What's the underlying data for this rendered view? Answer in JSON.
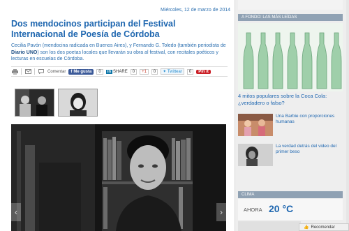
{
  "article": {
    "date": "Miércoles, 12 de marzo de 2014",
    "headline": "Dos mendocinos participan del Festival Internacional de Poesía de Córdoba",
    "lead_part1": "Cecilia Pavón (mendocina radicada en Buenos Aires), y Fernando G. Toledo (también periodista de ",
    "lead_bold": "Diario UNO",
    "lead_part2": ") son los dos poetas locales que llevarán su obra al festival, con recitales poéticos y lecturas en escuelas de Córdoba."
  },
  "toolbar": {
    "comment_label": "Comentar",
    "fb_like_label": "Me gusta",
    "fb_count": "0",
    "in_label": "in",
    "share_label": "SHARE",
    "share_count": "0",
    "gplus_label": "+1",
    "gplus_count": "0",
    "twitter_label": "Twittear",
    "twitter_count": "0",
    "pinit_label": "Pin it"
  },
  "gallery": {
    "prev_symbol": "‹",
    "next_symbol": "›"
  },
  "sidebar": {
    "section_title": "A FONDO: LAS MÁS LEÍDAS",
    "featured_caption": "4 mitos populares sobre la Coca Cola: ¿verdadero o falso?",
    "items": [
      {
        "text": "Una Barbie con proporciones humanas"
      },
      {
        "text": "La verdad detrás del video del primer beso"
      }
    ],
    "clima_title": "CLIMA",
    "ahora_label": "AHORA",
    "temperature": "20 °C"
  },
  "recommend": {
    "label": "Recomendar"
  },
  "colors": {
    "link_blue": "#1f67b0",
    "header_gray_blue": "#8fa1b3",
    "facebook": "#3b5998",
    "linkedin": "#0e76a8",
    "pinterest": "#cb2027"
  }
}
